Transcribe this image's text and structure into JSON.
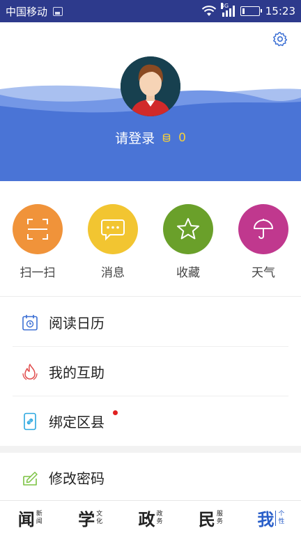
{
  "status_bar": {
    "carrier": "中国移动",
    "network": "4G",
    "time": "15:23"
  },
  "header": {
    "login_text": "请登录",
    "coin_count": "0"
  },
  "quick_actions": [
    {
      "label": "扫一扫",
      "color": "#f0933a",
      "icon": "scan-icon"
    },
    {
      "label": "消息",
      "color": "#f2c531",
      "icon": "message-icon"
    },
    {
      "label": "收藏",
      "color": "#6aa02a",
      "icon": "star-icon"
    },
    {
      "label": "天气",
      "color": "#c0388e",
      "icon": "umbrella-icon"
    }
  ],
  "menu": [
    {
      "label": "阅读日历",
      "icon": "calendar-icon"
    },
    {
      "label": "我的互助",
      "icon": "flame-icon"
    },
    {
      "label": "绑定区县",
      "icon": "phone-link-icon"
    },
    {
      "label": "修改密码",
      "icon": "edit-lock-icon"
    }
  ],
  "bottom_nav": [
    {
      "big": "闻",
      "small": [
        "新",
        "闻"
      ],
      "active": false
    },
    {
      "big": "学",
      "small": [
        "文",
        "化"
      ],
      "active": false
    },
    {
      "big": "政",
      "small": [
        "政",
        "务"
      ],
      "active": false
    },
    {
      "big": "民",
      "small": [
        "服",
        "务"
      ],
      "active": false
    },
    {
      "big": "我",
      "small": [
        "个",
        "性"
      ],
      "active": true
    }
  ],
  "colors": {
    "header_blue": "#4a74d6",
    "status_bar": "#2d3a8c",
    "active_nav": "#2a5fc9",
    "coin": "#f4cf3c"
  }
}
